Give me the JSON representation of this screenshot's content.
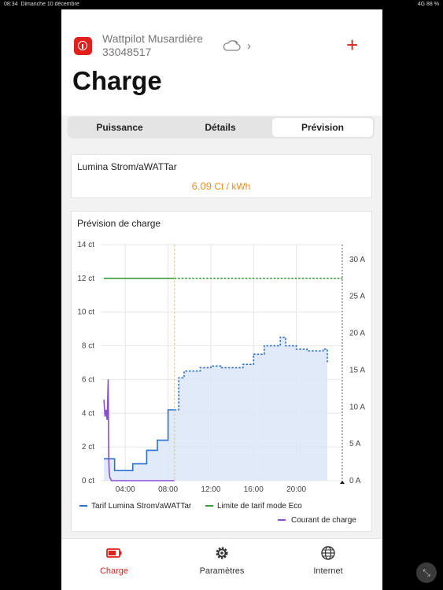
{
  "status": {
    "time": "08:34",
    "date": "Dimanche 10 décembre",
    "right": "4G 88 %"
  },
  "header": {
    "device_name": "Wattpilot Musardière",
    "device_id": "33048517",
    "title": "Charge"
  },
  "tabs": [
    {
      "label": "Puissance",
      "active": false
    },
    {
      "label": "Détails",
      "active": false
    },
    {
      "label": "Prévision",
      "active": true
    }
  ],
  "tariff": {
    "provider": "Lumina Strom/aWATTar",
    "value": "6.09",
    "unit": "Ct / kWh"
  },
  "forecast": {
    "title": "Prévision de charge"
  },
  "chart_data": {
    "type": "line",
    "title": "Prévision de charge",
    "x_ticks": [
      "04:00",
      "08:00",
      "12:00",
      "16:00",
      "20:00"
    ],
    "y_left_ticks": [
      "0 ct",
      "2 ct",
      "4 ct",
      "6 ct",
      "8 ct",
      "10 ct",
      "12 ct",
      "14 ct"
    ],
    "y_left_range": [
      0,
      14
    ],
    "y_right_ticks": [
      "0 A",
      "5 A",
      "10 A",
      "15 A",
      "20 A",
      "25 A",
      "30 A"
    ],
    "y_right_range": [
      0,
      32
    ],
    "x_range_hours": [
      1.7,
      24.3
    ],
    "now_hour": 8.6,
    "series": [
      {
        "name": "Tarif Lumina Strom/aWATTar",
        "color": "#2f6fd0",
        "x": [
          2.0,
          3.0,
          4.0,
          4.7,
          5.0,
          6.0,
          7.0,
          8.0,
          9.0,
          9.5,
          11.0,
          12.0,
          13.0,
          14.0,
          15.0,
          16.0,
          17.0,
          18.0,
          18.5,
          19.0,
          20.0,
          21.0,
          22.0,
          22.5,
          22.9
        ],
        "y": [
          1.3,
          0.6,
          0.6,
          1.0,
          1.0,
          1.8,
          2.4,
          4.2,
          6.1,
          6.5,
          6.7,
          6.8,
          6.7,
          6.7,
          6.9,
          7.5,
          8.0,
          8.0,
          8.5,
          8.0,
          7.8,
          7.7,
          7.7,
          7.8,
          7.0
        ]
      },
      {
        "name": "Limite de tarif mode Eco",
        "color": "#3a9a3a",
        "constant": 12
      },
      {
        "name": "Courant de charge",
        "color": "#8a4fcf",
        "x": [
          2.0,
          2.1,
          2.2,
          2.3,
          2.4,
          2.45,
          2.5,
          2.55,
          2.7,
          8.6
        ],
        "y": [
          4.8,
          3.8,
          4.2,
          3.6,
          6.0,
          1.3,
          0.5,
          0.2,
          0.0,
          0.0
        ]
      }
    ],
    "legend_position": "bottom"
  },
  "bottom_nav": [
    {
      "label": "Charge",
      "icon": "battery-icon",
      "active": true
    },
    {
      "label": "Paramètres",
      "icon": "gear-icon",
      "active": false
    },
    {
      "label": "Internet",
      "icon": "globe-icon",
      "active": false
    }
  ],
  "colors": {
    "accent": "#e0201c",
    "tariff_value": "#f28c1b"
  }
}
